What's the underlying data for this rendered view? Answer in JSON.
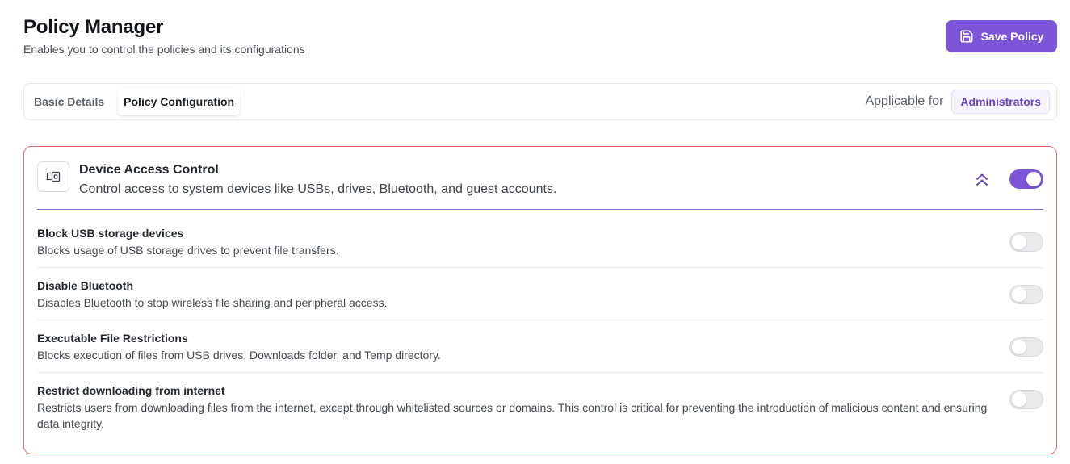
{
  "header": {
    "title": "Policy Manager",
    "subtitle": "Enables you to control the policies and its configurations",
    "save_label": "Save Policy"
  },
  "tabs": [
    {
      "label": "Basic Details",
      "active": false
    },
    {
      "label": "Policy Configuration",
      "active": true
    }
  ],
  "applicable": {
    "label": "Applicable for",
    "role": "Administrators"
  },
  "section": {
    "title": "Device Access Control",
    "description": "Control access to system devices like USBs, drives, Bluetooth, and guest accounts.",
    "enabled": true,
    "expanded": true,
    "items": [
      {
        "title": "Block USB storage devices",
        "description": "Blocks usage of USB storage drives to prevent file transfers.",
        "enabled": false
      },
      {
        "title": "Disable Bluetooth",
        "description": "Disables Bluetooth to stop wireless file sharing and peripheral access.",
        "enabled": false
      },
      {
        "title": "Executable File Restrictions",
        "description": "Blocks execution of files from USB drives, Downloads folder, and Temp directory.",
        "enabled": false
      },
      {
        "title": "Restrict downloading from internet",
        "description": "Restricts users from downloading files from the internet, except through whitelisted sources or domains. This control is critical for preventing the introduction of malicious content and ensuring data integrity.",
        "enabled": false
      }
    ]
  },
  "colors": {
    "accent": "#7c55d8",
    "card_border": "#e57373",
    "toggle_off": "#e9eaec"
  },
  "icons": {
    "save": "save-icon",
    "device": "device-access-icon",
    "collapse": "chevrons-up-icon"
  }
}
